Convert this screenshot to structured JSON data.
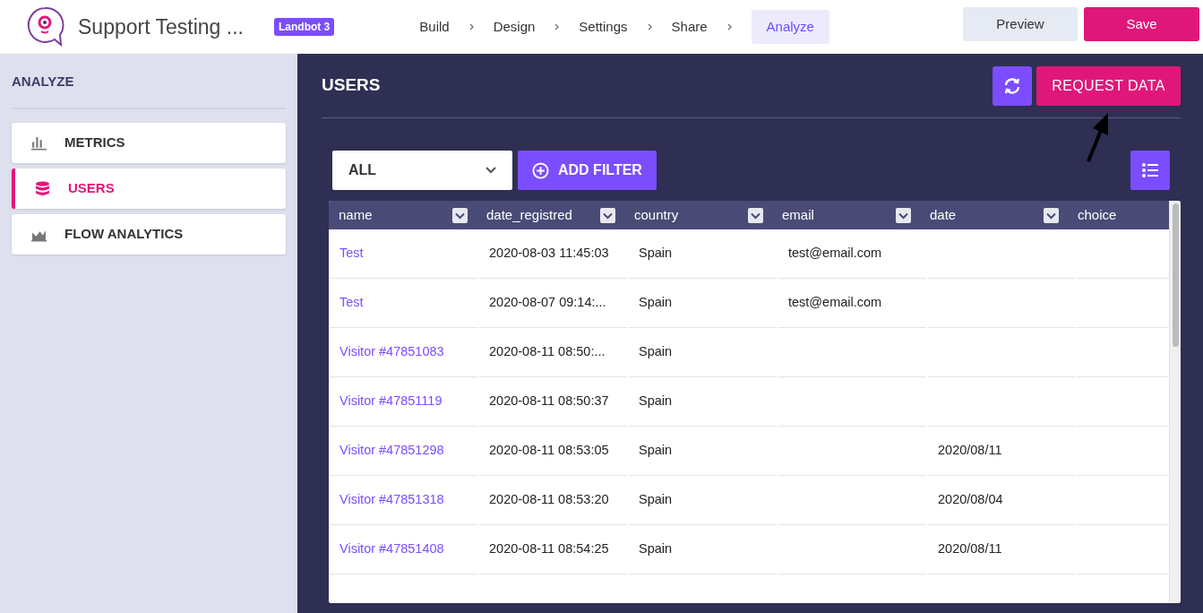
{
  "topbar": {
    "title": "Support Testing ...",
    "badge": "Landbot 3",
    "steps": [
      {
        "label": "Build",
        "selected": false
      },
      {
        "label": "Design",
        "selected": false
      },
      {
        "label": "Settings",
        "selected": false
      },
      {
        "label": "Share",
        "selected": false
      },
      {
        "label": "Analyze",
        "selected": true
      }
    ],
    "buttons": {
      "preview": "Preview",
      "save": "Save"
    }
  },
  "sidebar": {
    "heading": "ANALYZE",
    "items": [
      {
        "label": "METRICS",
        "kind": "metrics",
        "selected": false
      },
      {
        "label": "USERS",
        "kind": "users",
        "selected": true
      },
      {
        "label": "FLOW ANALYTICS",
        "kind": "flow",
        "selected": false
      }
    ]
  },
  "main": {
    "title": "USERS",
    "request_button": "REQUEST DATA",
    "filter": {
      "value": "ALL"
    },
    "add_filter": "ADD FILTER",
    "table": {
      "columns": [
        "name",
        "date_registred",
        "country",
        "email",
        "date",
        "choice"
      ],
      "rows": [
        {
          "cells": [
            "Test",
            "2020-08-03 11:45:03",
            "Spain",
            "test@email.com",
            null,
            null
          ]
        },
        {
          "cells": [
            "Test",
            "2020-08-07 09:14:...",
            "Spain",
            "test@email.com",
            null,
            null
          ]
        },
        {
          "cells": [
            "Visitor #47851083",
            "2020-08-11 08:50:...",
            "Spain",
            null,
            null,
            null
          ]
        },
        {
          "cells": [
            "Visitor #47851119",
            "2020-08-11 08:50:37",
            "Spain",
            null,
            null,
            null
          ]
        },
        {
          "cells": [
            "Visitor #47851298",
            "2020-08-11 08:53:05",
            "Spain",
            null,
            "2020/08/11",
            null
          ]
        },
        {
          "cells": [
            "Visitor #47851318",
            "2020-08-11 08:53:20",
            "Spain",
            null,
            "2020/08/04",
            null
          ]
        },
        {
          "cells": [
            "Visitor #47851408",
            "2020-08-11 08:54:25",
            "Spain",
            null,
            "2020/08/11",
            null
          ]
        }
      ]
    }
  }
}
